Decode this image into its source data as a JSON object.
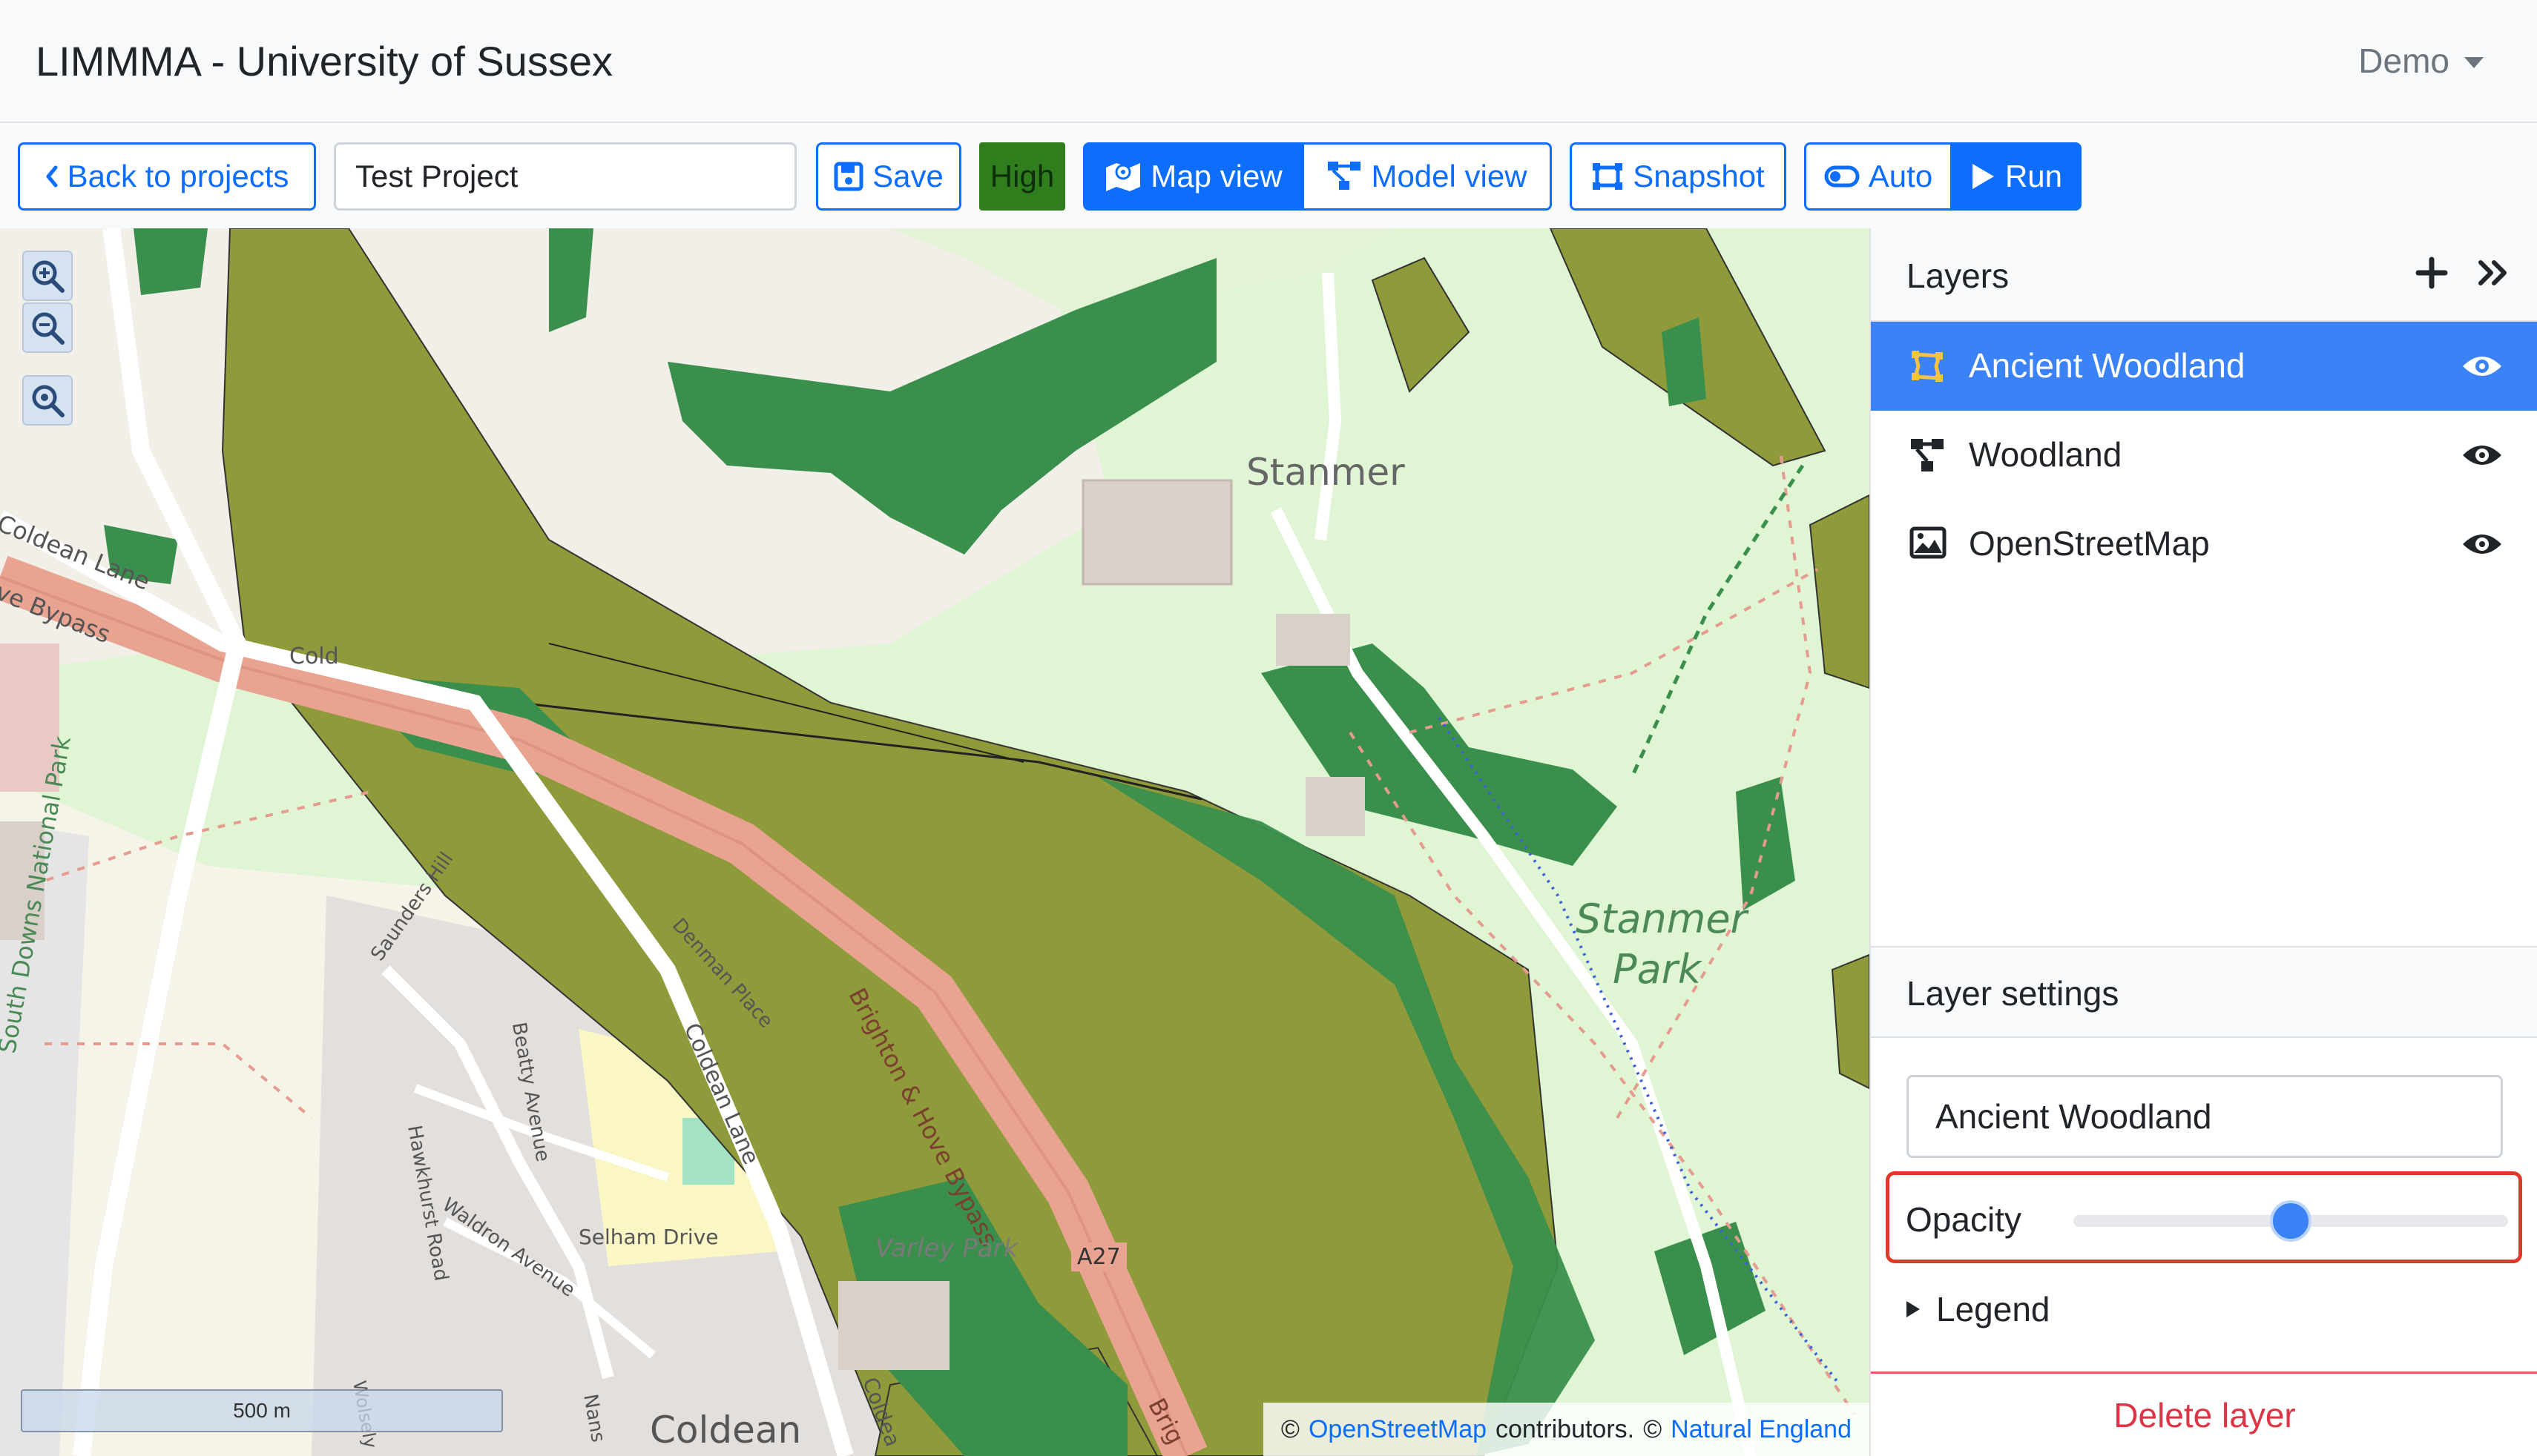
{
  "app": {
    "title": "LIMMMA - University of Sussex",
    "user_menu": "Demo"
  },
  "toolbar": {
    "back_label": "Back to projects",
    "project_name": "Test Project",
    "save_label": "Save",
    "quality_label": "High",
    "map_view_label": "Map view",
    "model_view_label": "Model view",
    "snapshot_label": "Snapshot",
    "auto_label": "Auto",
    "run_label": "Run"
  },
  "map": {
    "scale_label": "500 m",
    "attribution": {
      "prefix": "©",
      "osm_link": "OpenStreetMap",
      "osm_suffix": "contributors.",
      "ne_prefix": "©",
      "ne_link": "Natural England"
    },
    "labels": {
      "stanmer_village": "Stanmer",
      "stanmer_park_1": "Stanmer",
      "stanmer_park_2": "Park",
      "coldean_lane_top": "Coldean Lane",
      "bypass_left": "ve Bypass",
      "south_downs": "South Downs National Park",
      "saunders_hill": "Saunders Hill",
      "denman_place": "Denman Place",
      "coldean_lane_mid": "Coldean Lane",
      "brighton_bypass": "Brighton & Hove Bypass",
      "beatty_avenue": "Beatty Avenue",
      "hawkhurst_road": "Hawkhurst Road",
      "waldron_avenue": "Waldron Avenue",
      "selham_drive": "Selham Drive",
      "varley_park": "Varley Park",
      "a27": "A27",
      "coldean": "Coldean",
      "cold_fragment": "Cold",
      "brig_fragment": "Brig",
      "coldea_fragment": "Coldea",
      "nans_fragment": "Nans",
      "wolseley_fragment": "Wolsely"
    },
    "colors": {
      "ancient_woodland": "#8f9a3a",
      "woodland": "#3a8f4c",
      "park": "#dff5d3",
      "road_major": "#e8a391",
      "road_minor": "#ffffff"
    }
  },
  "layers_panel": {
    "title": "Layers",
    "add_icon": "plus-icon",
    "collapse_icon": "double-chevron-right-icon",
    "items": [
      {
        "name": "Ancient Woodland",
        "icon": "polygon-icon",
        "active": true
      },
      {
        "name": "Woodland",
        "icon": "model-icon",
        "active": false
      },
      {
        "name": "OpenStreetMap",
        "icon": "image-icon",
        "active": false
      }
    ]
  },
  "layer_settings": {
    "title": "Layer settings",
    "name_value": "Ancient Woodland",
    "opacity_label": "Opacity",
    "opacity_value": 0.5,
    "legend_label": "Legend",
    "delete_label": "Delete layer"
  }
}
